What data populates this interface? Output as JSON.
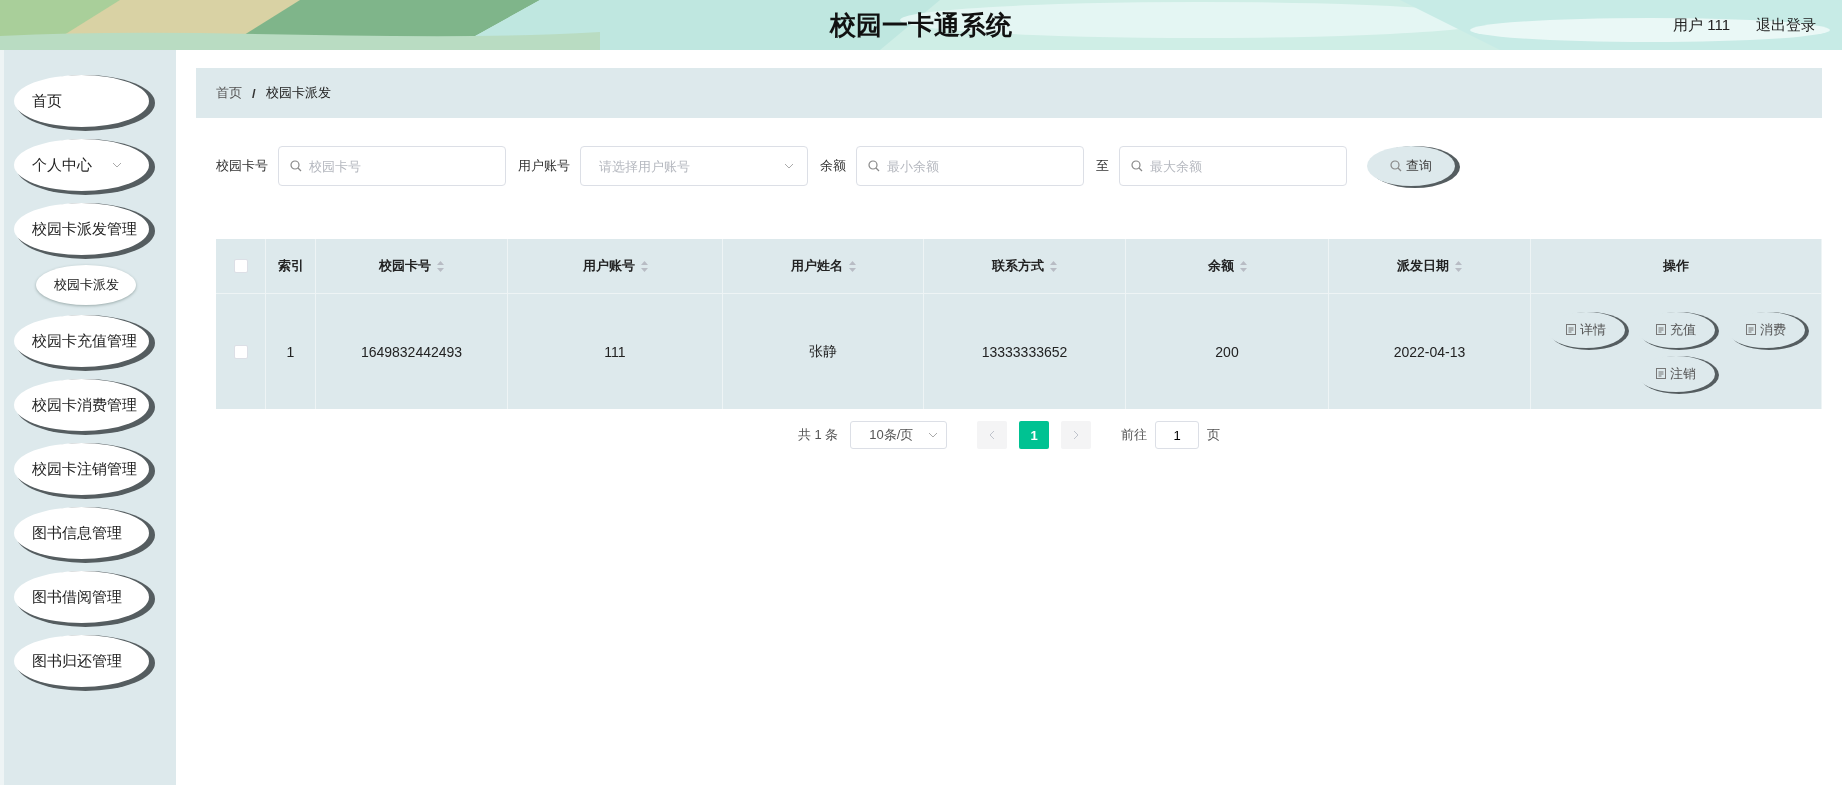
{
  "header": {
    "title": "校园一卡通系统",
    "user": "用户 111",
    "logout": "退出登录"
  },
  "sidebar": {
    "items": [
      {
        "label": "首页",
        "kind": "link"
      },
      {
        "label": "个人中心",
        "kind": "submenu"
      },
      {
        "label": "校园卡派发管理",
        "kind": "link",
        "children": [
          {
            "label": "校园卡派发"
          }
        ]
      },
      {
        "label": "校园卡充值管理",
        "kind": "link"
      },
      {
        "label": "校园卡消费管理",
        "kind": "link"
      },
      {
        "label": "校园卡注销管理",
        "kind": "link"
      },
      {
        "label": "图书信息管理",
        "kind": "link"
      },
      {
        "label": "图书借阅管理",
        "kind": "link"
      },
      {
        "label": "图书归还管理",
        "kind": "link"
      }
    ]
  },
  "breadcrumb": {
    "separator": "/",
    "items": [
      "首页",
      "校园卡派发"
    ]
  },
  "search": {
    "fields": [
      {
        "label": "校园卡号",
        "placeholder": "校园卡号",
        "kind": "text"
      },
      {
        "label": "用户账号",
        "placeholder": "请选择用户账号",
        "kind": "select"
      },
      {
        "label": "余额",
        "placeholder": "最小余额",
        "kind": "text"
      },
      {
        "label": "至",
        "placeholder": "最大余额",
        "kind": "text"
      }
    ],
    "button": "查询"
  },
  "table": {
    "select_all_checked": false,
    "columns": [
      {
        "label": "索引",
        "sortable": false
      },
      {
        "label": "校园卡号",
        "sortable": true
      },
      {
        "label": "用户账号",
        "sortable": true
      },
      {
        "label": "用户姓名",
        "sortable": true
      },
      {
        "label": "联系方式",
        "sortable": true
      },
      {
        "label": "余额",
        "sortable": true
      },
      {
        "label": "派发日期",
        "sortable": true
      },
      {
        "label": "操作",
        "sortable": false
      }
    ],
    "rows": [
      {
        "checked": false,
        "cells": [
          "1",
          "1649832442493",
          "111",
          "张静",
          "13333333652",
          "200",
          "2022-04-13"
        ],
        "actions": [
          "详情",
          "充值",
          "消费",
          "注销"
        ]
      }
    ]
  },
  "pagination": {
    "total": "共 1 条",
    "page_size": "10条/页",
    "pages": [
      {
        "label": "1",
        "selected": true
      }
    ],
    "goto_label": "前往",
    "goto_value": "1",
    "goto_suffix": "页"
  }
}
